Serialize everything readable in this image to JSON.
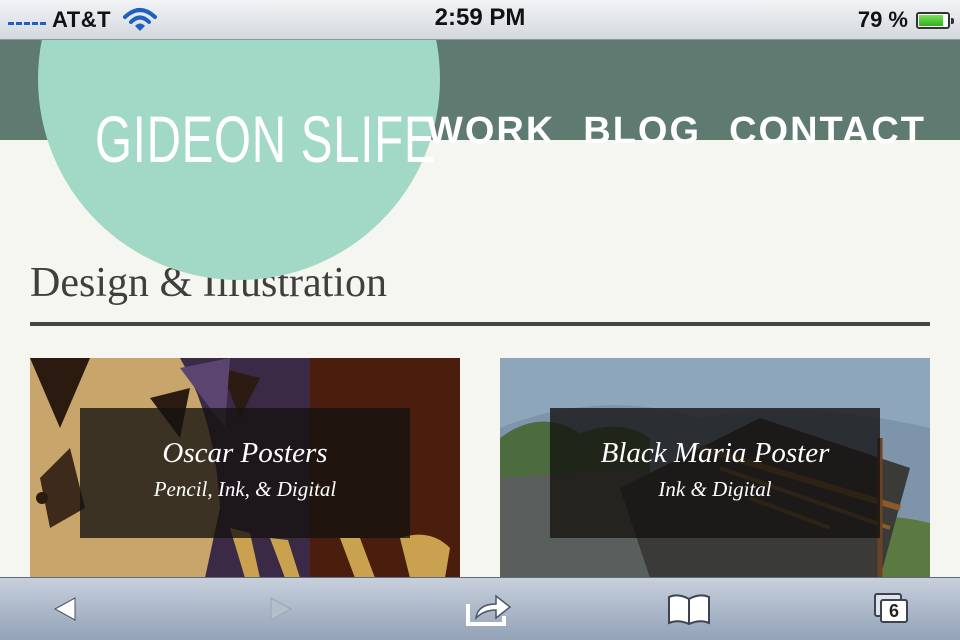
{
  "status_bar": {
    "carrier": "AT&T",
    "time": "2:59 PM",
    "battery_percent": "79 %",
    "battery_level": 0.79,
    "icons": [
      "signal-icon",
      "wifi-icon",
      "battery-icon"
    ]
  },
  "site": {
    "logo": "GIDEON SLIFE",
    "nav": [
      "WORK",
      "BLOG",
      "CONTACT"
    ],
    "section_title": "Design & Illustration",
    "projects": [
      {
        "title": "Oscar Posters",
        "subtitle": "Pencil, Ink, & Digital"
      },
      {
        "title": "Black Maria Poster",
        "subtitle": "Ink & Digital"
      }
    ]
  },
  "toolbar": {
    "tabs_count": "6",
    "icons": [
      "back-arrow-icon",
      "forward-arrow-icon",
      "share-icon",
      "bookmarks-icon",
      "tabs-icon"
    ]
  },
  "colors": {
    "header_bg": "#5f7a70",
    "logo_circle": "#a2d8c6",
    "page_bg": "#f6f6f1",
    "text_dark": "#3f3f3d"
  }
}
